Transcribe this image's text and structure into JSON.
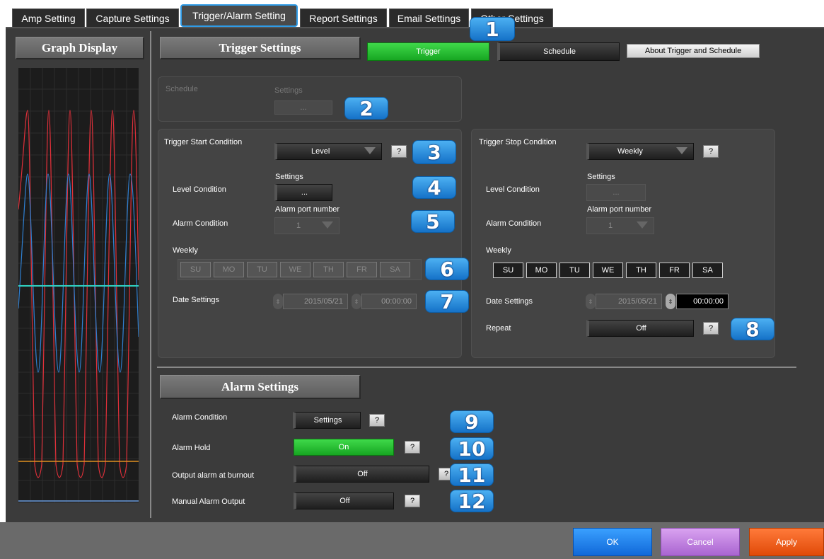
{
  "tabs": [
    {
      "label": "Amp Setting"
    },
    {
      "label": "Capture Settings"
    },
    {
      "label": "Trigger/Alarm Setting"
    },
    {
      "label": "Report Settings"
    },
    {
      "label": "Email Settings"
    },
    {
      "label": "Other Settings"
    }
  ],
  "graph": {
    "title": "Graph Display"
  },
  "trigger": {
    "title": "Trigger Settings",
    "mode_trigger": "Trigger",
    "mode_schedule": "Schedule",
    "about": "About Trigger and Schedule",
    "schedule_label": "Schedule",
    "schedule_settings_label": "Settings",
    "schedule_settings_btn": "...",
    "start": {
      "title": "Trigger Start Condition",
      "condition": "Level",
      "help": "?",
      "settings_label": "Settings",
      "level_label": "Level Condition",
      "level_btn": "...",
      "alarm_port_label": "Alarm port number",
      "alarm_label": "Alarm Condition",
      "alarm_port": "1",
      "weekly_label": "Weekly",
      "days": [
        "SU",
        "MO",
        "TU",
        "WE",
        "TH",
        "FR",
        "SA"
      ],
      "date_label": "Date Settings",
      "date": "2015/05/21",
      "time": "00:00:00"
    },
    "stop": {
      "title": "Trigger Stop Condition",
      "condition": "Weekly",
      "help": "?",
      "settings_label": "Settings",
      "level_label": "Level Condition",
      "level_btn": "...",
      "alarm_port_label": "Alarm port number",
      "alarm_label": "Alarm Condition",
      "alarm_port": "1",
      "weekly_label": "Weekly",
      "days": [
        "SU",
        "MO",
        "TU",
        "WE",
        "TH",
        "FR",
        "SA"
      ],
      "date_label": "Date Settings",
      "date": "2015/05/21",
      "time": "00:00:00",
      "repeat_label": "Repeat",
      "repeat": "Off"
    }
  },
  "alarm": {
    "title": "Alarm Settings",
    "condition_label": "Alarm Condition",
    "condition_btn": "Settings",
    "hold_label": "Alarm Hold",
    "hold": "On",
    "burnout_label": "Output alarm at burnout",
    "burnout": "Off",
    "manual_label": "Manual Alarm Output",
    "manual": "Off",
    "help": "?"
  },
  "badges": [
    "1",
    "2",
    "3",
    "4",
    "5",
    "6",
    "7",
    "8",
    "9",
    "10",
    "11",
    "12"
  ],
  "footer": {
    "ok": "OK",
    "cancel": "Cancel",
    "apply": "Apply"
  },
  "colors": {
    "ok": "#1a82f0",
    "cancel": "#c07ee0",
    "apply": "#f05a14",
    "accent_green": "#22c22e",
    "badge_blue": "#2a8ee0",
    "trace_red": "#e0303a",
    "trace_blue": "#2f7fd0",
    "trace_cyan": "#2fd0c0",
    "trace_orange": "#e09020"
  }
}
